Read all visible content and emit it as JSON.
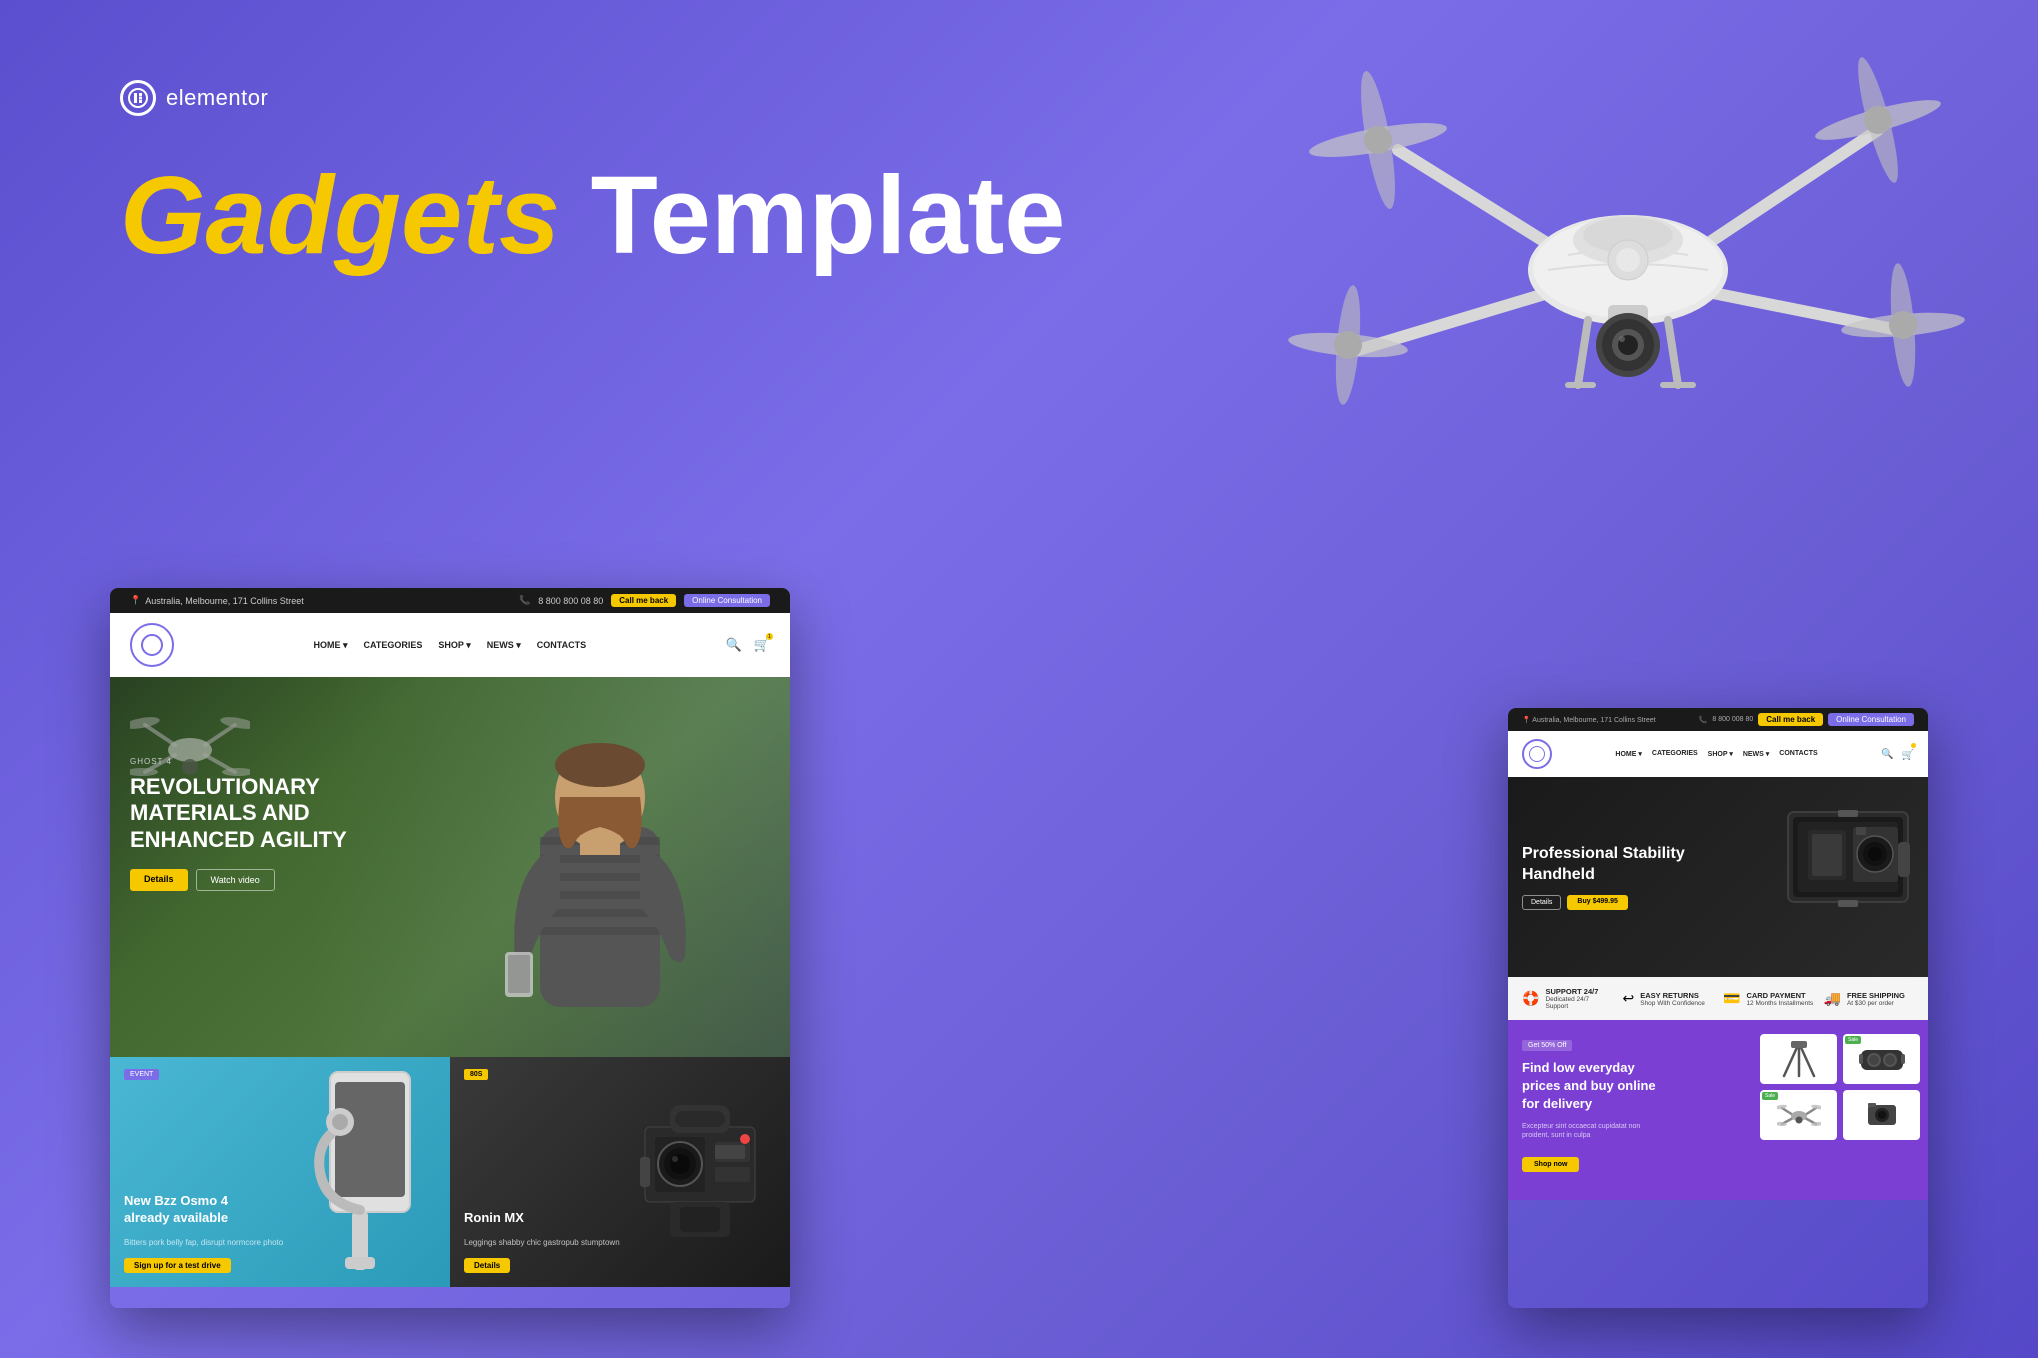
{
  "brand": {
    "logo_text": "elementor",
    "logo_icon": "⊕"
  },
  "hero": {
    "title_part1": "Gadgets",
    "title_part2": "Template"
  },
  "mockup_left": {
    "header_top": {
      "address": "Australia, Melbourne, 171 Collins Street",
      "phone": "8 800 800 08 80",
      "btn_callback": "Call me back",
      "btn_consult": "Online Consultation"
    },
    "nav": {
      "links": [
        "HOME",
        "CATEGORIES",
        "SHOP",
        "NEWS",
        "CONTACTS"
      ]
    },
    "hero": {
      "label": "GHOST 4",
      "title": "REVOLUTIONARY\nMATERIALS AND\nENHANCED AGILITY",
      "btn_details": "Details",
      "btn_video": "Watch video"
    },
    "cards": [
      {
        "label": "EVENT",
        "title": "New Bzz Osmo 4\nalready available",
        "subtitle": "Bitters pork belly fap, disrupt normcore photo",
        "btn": "Sign up for a test drive"
      },
      {
        "label": "80s",
        "title": "Ronin MX",
        "subtitle": "Leggings shabby chic gastropub stumptown",
        "btn": "Details"
      }
    ]
  },
  "mockup_right": {
    "header_top": {
      "address": "Australia, Melbourne, 171 Collins Street",
      "phone": "8 800 008 80",
      "btn_callback": "Call me back",
      "btn_consult": "Online Consultation"
    },
    "nav": {
      "links": [
        "HOME",
        "CATEGORIES",
        "SHOP",
        "NEWS",
        "CONTACTS"
      ]
    },
    "hero": {
      "title": "Professional Stability\nHandheld",
      "btn_details": "Details",
      "btn_buy": "Buy $499.95"
    },
    "features": [
      {
        "icon": "🛟",
        "title": "SUPPORT 24/7",
        "text": "Dedicated 24/7 Support"
      },
      {
        "icon": "↩",
        "title": "EASY RETURNS",
        "text": "Shop With Confidence"
      },
      {
        "icon": "💳",
        "title": "CARD PAYMENT",
        "text": "12 Months Installments"
      },
      {
        "icon": "🚚",
        "title": "FREE SHIPPING",
        "text": "At $30 per order"
      }
    ],
    "sale": {
      "badge": "Get 50% Off",
      "title": "Find low everyday prices and buy online for delivery",
      "subtitle": "Excepteur sint occaecat cupidatat non proident, sunt in culpa",
      "btn": "Shop now"
    }
  }
}
